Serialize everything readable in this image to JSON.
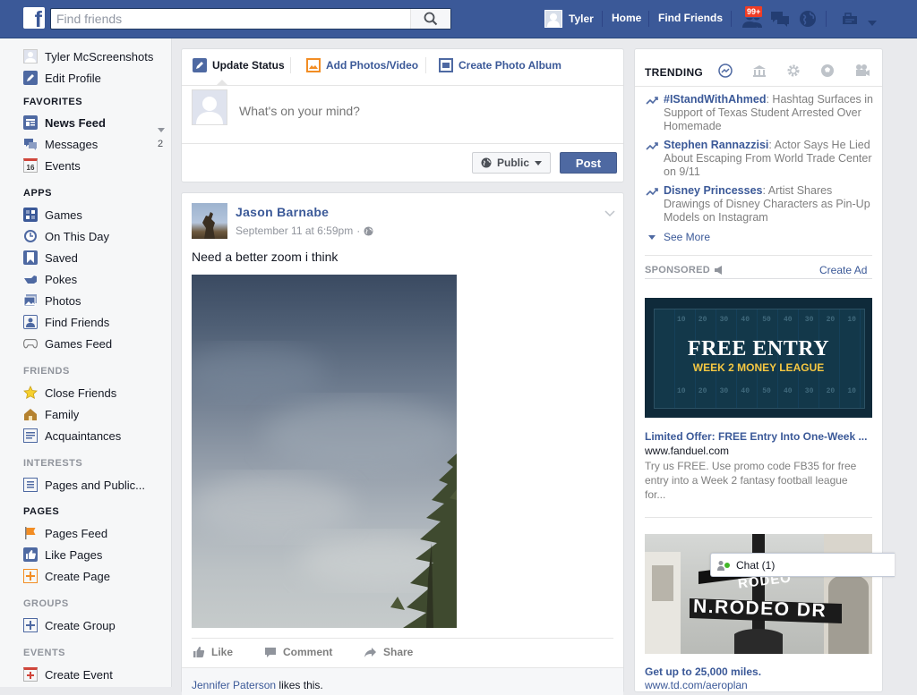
{
  "topbar": {
    "logo_letter": "f",
    "search_placeholder": "Find friends",
    "user_name": "Tyler",
    "home_label": "Home",
    "find_friends_label": "Find Friends",
    "notification_badge": "99+",
    "colors": {
      "bar": "#3b5998",
      "badge": "#f03d25"
    }
  },
  "left_nav": {
    "profile_name": "Tyler McScreenshots",
    "edit_profile": "Edit Profile",
    "sections": {
      "favorites": "FAVORITES",
      "apps": "APPS",
      "friends": "FRIENDS",
      "interests": "INTERESTS",
      "pages": "PAGES",
      "groups": "GROUPS",
      "events": "EVENTS"
    },
    "favorites": [
      {
        "label": "News Feed",
        "icon": "news-feed-icon"
      },
      {
        "label": "Messages",
        "icon": "messages-icon",
        "count": "2"
      },
      {
        "label": "Events",
        "icon": "calendar-icon",
        "icon_text": "16"
      }
    ],
    "apps": [
      {
        "label": "Games",
        "icon": "games-icon"
      },
      {
        "label": "On This Day",
        "icon": "clock-icon"
      },
      {
        "label": "Saved",
        "icon": "bookmark-icon"
      },
      {
        "label": "Pokes",
        "icon": "poke-icon"
      },
      {
        "label": "Photos",
        "icon": "photos-icon"
      },
      {
        "label": "Find Friends",
        "icon": "find-friends-icon"
      },
      {
        "label": "Games Feed",
        "icon": "gamepad-icon"
      }
    ],
    "friends": [
      {
        "label": "Close Friends",
        "icon": "star-icon"
      },
      {
        "label": "Family",
        "icon": "family-icon"
      },
      {
        "label": "Acquaintances",
        "icon": "acquaintances-icon"
      }
    ],
    "interests": [
      {
        "label": "Pages and Public...",
        "icon": "list-icon"
      }
    ],
    "pages": [
      {
        "label": "Pages Feed",
        "icon": "flag-icon"
      },
      {
        "label": "Like Pages",
        "icon": "thumbs-up-icon"
      },
      {
        "label": "Create Page",
        "icon": "plus-icon"
      }
    ],
    "groups": [
      {
        "label": "Create Group",
        "icon": "plus-icon"
      }
    ],
    "events": [
      {
        "label": "Create Event",
        "icon": "plus-icon"
      }
    ]
  },
  "composer": {
    "tabs": [
      "Update Status",
      "Add Photos/Video",
      "Create Photo Album"
    ],
    "placeholder": "What's on your mind?",
    "privacy_label": "Public",
    "post_label": "Post"
  },
  "post": {
    "author": "Jason Barnabe",
    "timestamp": "September 11 at 6:59pm",
    "text": "Need a better zoom i think",
    "actions": [
      "Like",
      "Comment",
      "Share"
    ],
    "likes_name": "Jennifer Paterson",
    "likes_suffix": " likes this."
  },
  "trending": {
    "title": "TRENDING",
    "items": [
      {
        "topic": "#IStandWithAhmed",
        "desc": ": Hashtag Surfaces in Support of Texas Student Arrested Over Homemade"
      },
      {
        "topic": "Stephen Rannazzisi",
        "desc": ": Actor Says He Lied About Escaping From World Trade Center on 9/11"
      },
      {
        "topic": "Disney Princesses",
        "desc": ": Artist Shares Drawings of Disney Characters as Pin-Up Models on Instagram"
      }
    ],
    "see_more": "See More"
  },
  "sponsored": {
    "title": "SPONSORED",
    "create_ad": "Create Ad",
    "ads": [
      {
        "image_text_main": "FREE ENTRY",
        "image_text_sub": "WEEK 2 MONEY LEAGUE",
        "yard_numbers": [
          "10",
          "20",
          "30",
          "40",
          "50",
          "40",
          "30",
          "20",
          "10"
        ],
        "title": "Limited Offer: FREE Entry Into One-Week ...",
        "url": "www.fanduel.com",
        "body": "Try us FREE. Use promo code FB35 for free entry into a Week 2 fantasy football league for..."
      },
      {
        "image_text_main": "N.RODEO DR",
        "image_text_sub": "RODEO",
        "title": "Get up to 25,000 miles.",
        "url": "www.td.com/aeroplan"
      }
    ]
  },
  "chat": {
    "label": "Chat (1)"
  }
}
